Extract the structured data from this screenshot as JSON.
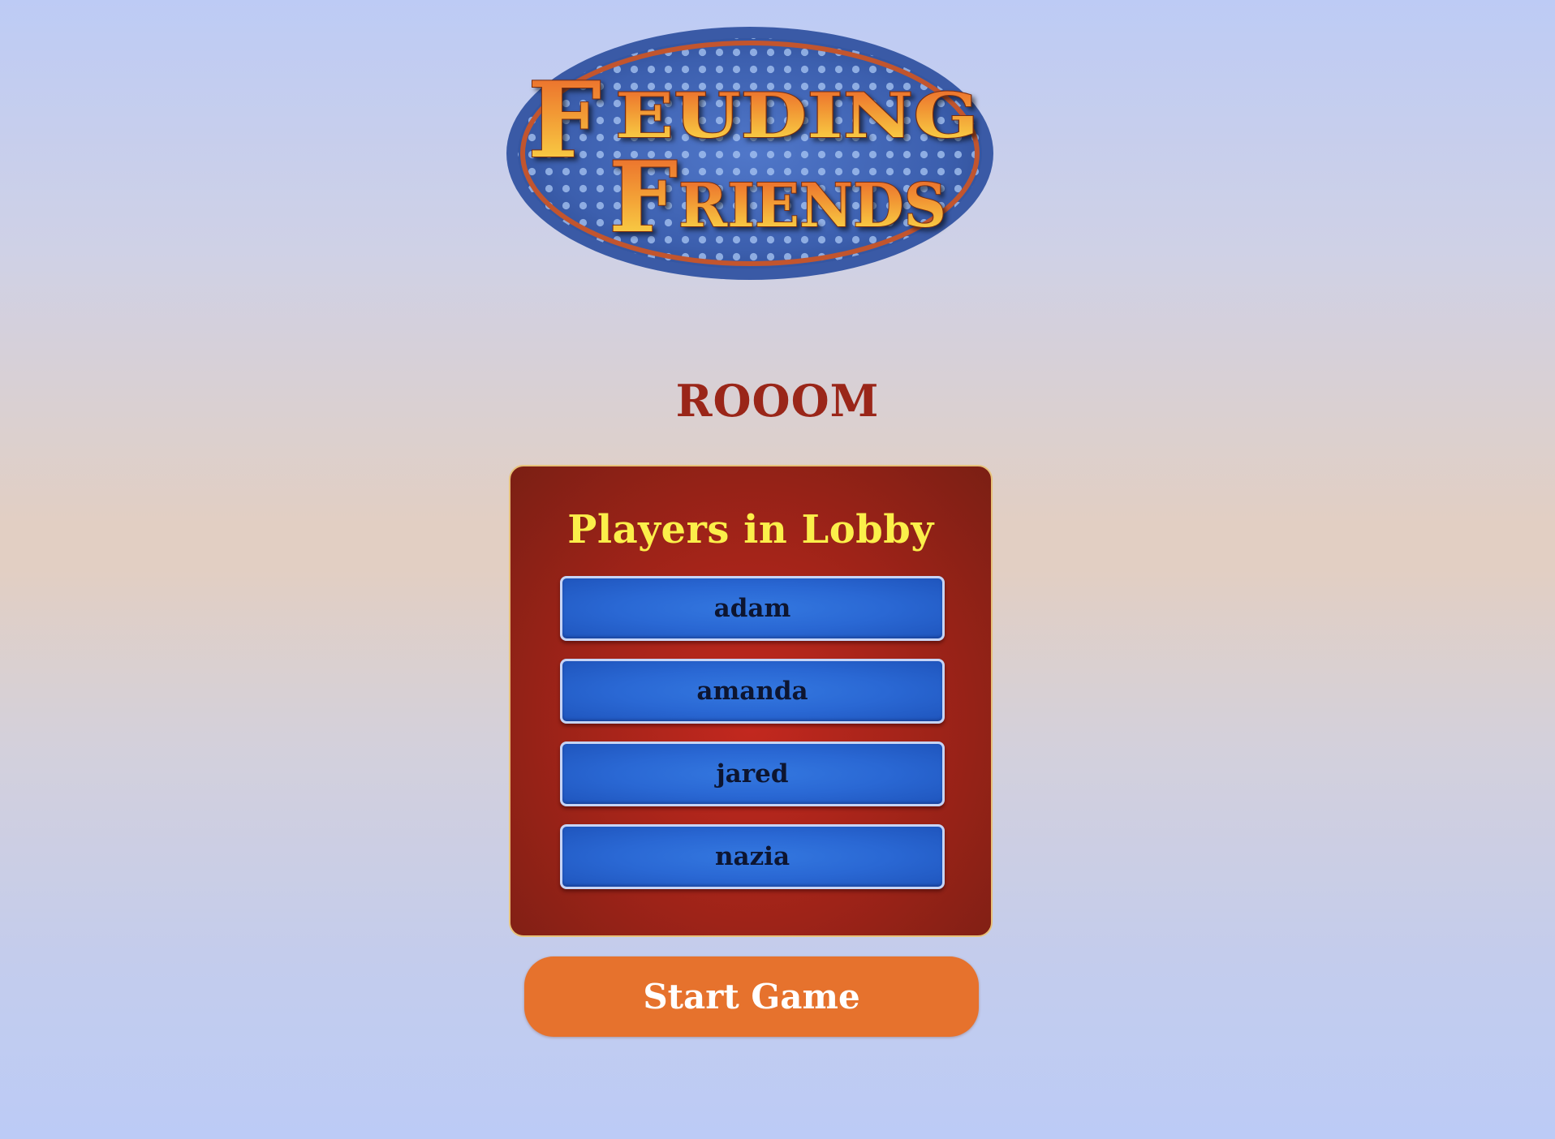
{
  "logo": {
    "line1": "FEUDING",
    "line2": "FRIENDS",
    "colors": {
      "oval": "#3f64b3",
      "ring": "#c2552e",
      "text_top": "#fbe34a",
      "text_bottom": "#e7662a"
    }
  },
  "room": {
    "name": "ROOOM"
  },
  "lobby": {
    "heading": "Players in Lobby",
    "players": [
      {
        "name": "adam"
      },
      {
        "name": "amanda"
      },
      {
        "name": "jared"
      },
      {
        "name": "nazia"
      }
    ]
  },
  "actions": {
    "start_label": "Start Game"
  },
  "colors": {
    "room_title": "#9a2619",
    "panel": "#b0251a",
    "heading": "#fbef4a",
    "player_tile": "#2a68d4",
    "start_button": "#e6722d"
  }
}
